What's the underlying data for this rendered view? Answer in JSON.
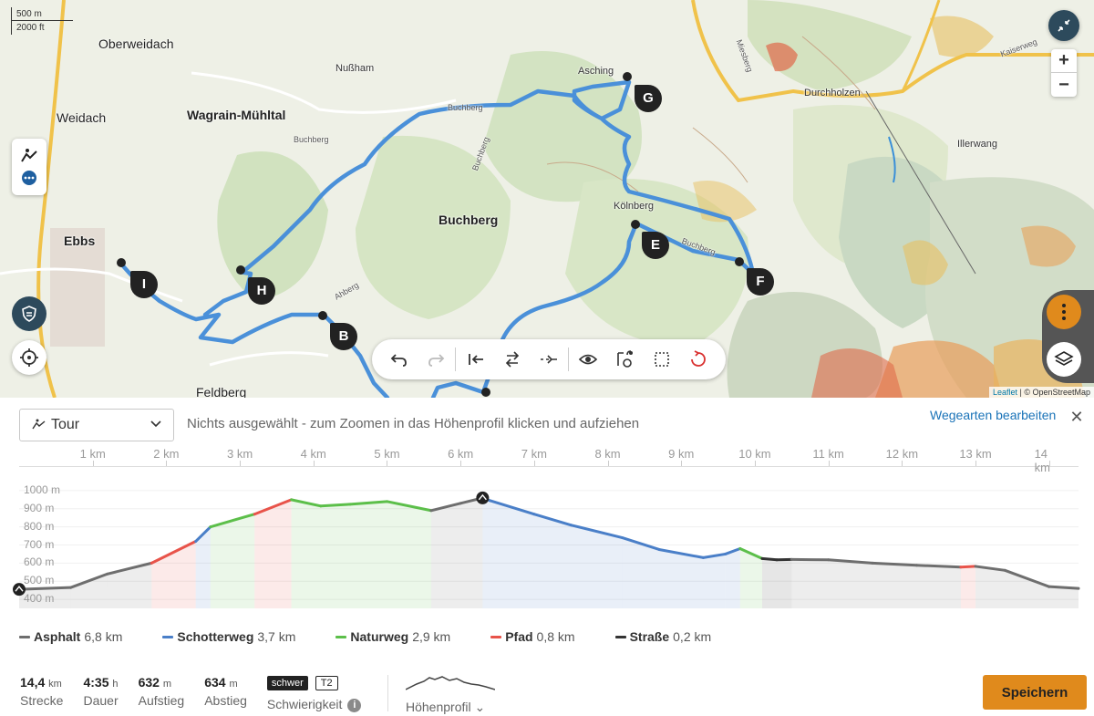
{
  "map": {
    "scale": {
      "metric": "500 m",
      "imperial": "2000 ft"
    },
    "labels": [
      {
        "text": "Oberweidach",
        "kind": "town"
      },
      {
        "text": "Nußham",
        "kind": "village"
      },
      {
        "text": "Asching",
        "kind": "village"
      },
      {
        "text": "Weidach",
        "kind": "town"
      },
      {
        "text": "Wagrain-Mühltal",
        "kind": "town bold"
      },
      {
        "text": "Buchberg",
        "kind": "road"
      },
      {
        "text": "Buchberg",
        "kind": "road"
      },
      {
        "text": "Buchberg",
        "kind": "town bold"
      },
      {
        "text": "Kölnberg",
        "kind": "village"
      },
      {
        "text": "Ebbs",
        "kind": "town bold"
      },
      {
        "text": "Feldberg",
        "kind": "town"
      },
      {
        "text": "Durchholzen",
        "kind": "village"
      },
      {
        "text": "Illerwang",
        "kind": "village"
      },
      {
        "text": "Kaiserweg",
        "kind": "road"
      },
      {
        "text": "Miesberg",
        "kind": "road"
      },
      {
        "text": "Ahberg",
        "kind": "road"
      },
      {
        "text": "Buchberg",
        "kind": "road"
      },
      {
        "text": "Buchberg",
        "kind": "road"
      }
    ],
    "waypoints": [
      "G",
      "E",
      "F",
      "H",
      "I",
      "B"
    ],
    "attribution": {
      "leaflet": "Leaflet",
      "osm": "| © OpenStreetMap"
    },
    "controls": {
      "zoom_in": "+",
      "zoom_out": "−"
    },
    "route_color": "#4a90d9"
  },
  "toolbar": {
    "buttons": [
      "undo-icon",
      "redo-icon",
      "route-to-start-icon",
      "reverse-route-icon",
      "return-to-start-icon",
      "visibility-icon",
      "add-poi-icon",
      "select-area-icon",
      "reset-icon"
    ]
  },
  "panel": {
    "select_value": "Tour",
    "hint": "Nichts ausgewählt - zum Zoomen in das Höhenprofil klicken und aufziehen",
    "edit_link": "Wegearten bearbeiten",
    "close": "✕",
    "km_ticks": [
      "1 km",
      "2 km",
      "3 km",
      "4 km",
      "5 km",
      "6 km",
      "7 km",
      "8 km",
      "9 km",
      "10 km",
      "11 km",
      "12 km",
      "13 km",
      "14 km"
    ],
    "y_ticks": [
      "1000 m",
      "900 m",
      "800 m",
      "700 m",
      "600 m",
      "500 m",
      "400 m"
    ]
  },
  "chart_data": {
    "type": "area",
    "xlabel": "",
    "ylabel": "",
    "x_unit": "km",
    "xlim": [
      0,
      14.4
    ],
    "ylim": [
      350,
      1050
    ],
    "x": [
      0,
      0.7,
      1.2,
      1.8,
      2.4,
      2.6,
      3.2,
      3.7,
      4.1,
      4.5,
      5.0,
      5.6,
      6.0,
      6.3,
      6.4,
      7.0,
      7.5,
      8.2,
      8.7,
      9.3,
      9.6,
      9.8,
      10.1,
      10.3,
      10.5,
      11.0,
      11.6,
      12.2,
      12.8,
      13.0,
      13.4,
      14.0,
      14.4
    ],
    "y": [
      455,
      465,
      540,
      600,
      720,
      800,
      870,
      950,
      915,
      925,
      940,
      890,
      930,
      960,
      945,
      870,
      810,
      740,
      675,
      630,
      650,
      680,
      625,
      618,
      620,
      618,
      600,
      588,
      578,
      582,
      560,
      470,
      460
    ],
    "surface": [
      "Asphalt",
      "Asphalt",
      "Asphalt",
      "Pfad",
      "Schotterweg",
      "Naturweg",
      "Pfad",
      "Naturweg",
      "Naturweg",
      "Naturweg",
      "Naturweg",
      "Asphalt",
      "Asphalt",
      "Schotterweg",
      "Schotterweg",
      "Schotterweg",
      "Schotterweg",
      "Schotterweg",
      "Schotterweg",
      "Schotterweg",
      "Schotterweg",
      "Naturweg",
      "Straße",
      "Straße",
      "Asphalt",
      "Asphalt",
      "Asphalt",
      "Asphalt",
      "Pfad",
      "Asphalt",
      "Asphalt",
      "Asphalt"
    ],
    "surface_colors": {
      "Asphalt": "#6e6e6e",
      "Schotterweg": "#4a7fc8",
      "Naturweg": "#5cbf4a",
      "Pfad": "#e8534a",
      "Straße": "#333333"
    },
    "legend": [
      {
        "name": "Asphalt",
        "value": "6,8 km",
        "color": "#6e6e6e"
      },
      {
        "name": "Schotterweg",
        "value": "3,7 km",
        "color": "#4a7fc8"
      },
      {
        "name": "Naturweg",
        "value": "2,9 km",
        "color": "#5cbf4a"
      },
      {
        "name": "Pfad",
        "value": "0,8 km",
        "color": "#e8534a"
      },
      {
        "name": "Straße",
        "value": "0,2 km",
        "color": "#333333"
      }
    ]
  },
  "stats": [
    {
      "value": "14,4",
      "unit": "km",
      "label": "Strecke"
    },
    {
      "value": "4:35",
      "unit": "h",
      "label": "Dauer"
    },
    {
      "value": "632",
      "unit": "m",
      "label": "Aufstieg"
    },
    {
      "value": "634",
      "unit": "m",
      "label": "Abstieg"
    }
  ],
  "difficulty": {
    "badge": "schwer",
    "grade": "T2",
    "label": "Schwierigkeit",
    "info": "i"
  },
  "profile_toggle": {
    "label": "Höhenprofil",
    "chevron": "⌄"
  },
  "save_label": "Speichern"
}
